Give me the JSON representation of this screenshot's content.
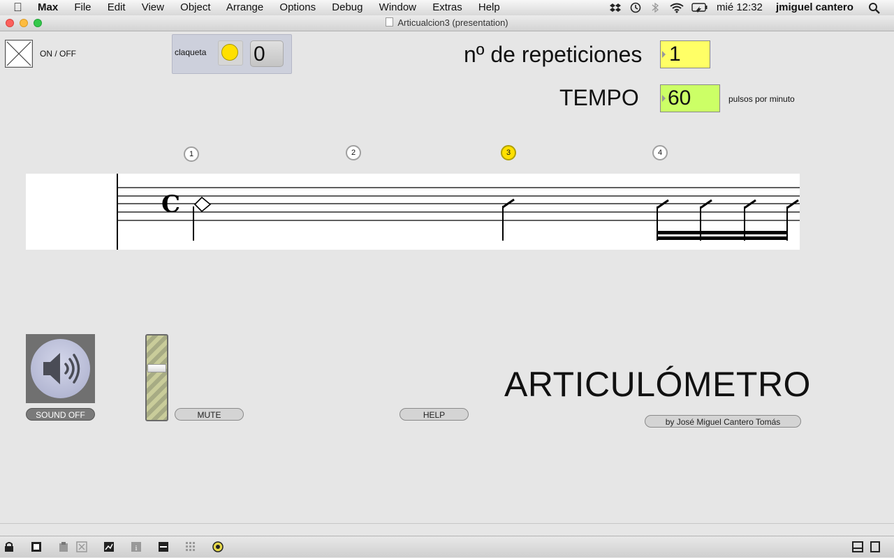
{
  "menubar": {
    "app": "Max",
    "items": [
      "File",
      "Edit",
      "View",
      "Object",
      "Arrange",
      "Options",
      "Debug",
      "Window",
      "Extras",
      "Help"
    ],
    "clock": "mié 12:32",
    "user": "jmiguel cantero"
  },
  "window": {
    "title": "Articualcion3 (presentation)"
  },
  "patch": {
    "onoff_label": "ON / OFF",
    "claqueta_label": "claqueta",
    "claqueta_value": "0",
    "repeticiones_label": "nº de repeticiones",
    "repeticiones_value": "1",
    "tempo_label": "TEMPO",
    "tempo_value": "60",
    "tempo_unit": "pulsos por minuto",
    "beats": [
      "1",
      "2",
      "3",
      "4"
    ],
    "active_beat": 3,
    "time_signature": "C",
    "sound_off_label": "SOUND OFF",
    "mute_label": "MUTE",
    "help_label": "HELP",
    "title": "ARTICULÓMETRO",
    "credit": "by José Miguel Cantero Tomás",
    "gain_level": 0.62
  },
  "colors": {
    "repeticiones_bg": "#ffff66",
    "tempo_bg": "#ccff66",
    "active_led": "#ffe000",
    "claqueta_panel": "#cdd0dc"
  },
  "toolbar_icons": [
    "lock-icon",
    "presentation-icon",
    "clipboard-icon",
    "clear-icon",
    "chart-icon",
    "info-icon",
    "connection-icon",
    "grid-icon",
    "palette-icon",
    "split-view-icon",
    "single-view-icon"
  ]
}
